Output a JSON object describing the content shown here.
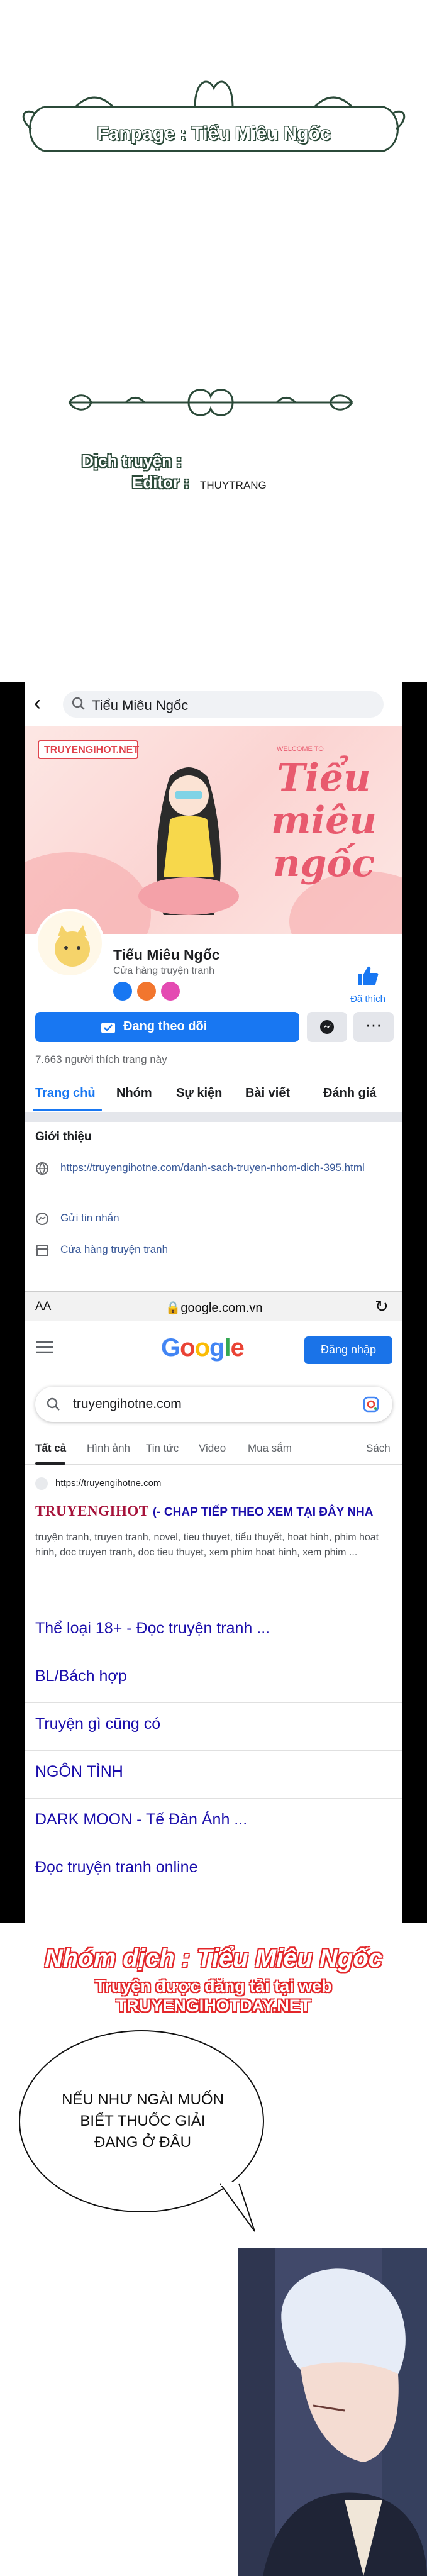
{
  "credit_top": {
    "fanpage": "Fanpage : Tiểu Miêu Ngốc",
    "translator_label": "Dịch truyện :",
    "editor_label": "Editor :",
    "editor_name": "THUYTRANG"
  },
  "facebook": {
    "search_query": "Tiểu Miêu Ngốc",
    "cover_brand": "TRUYENGIHOT.NET",
    "cover_welcome": "WELCOME TO",
    "cover_title": "Tiểu miêu ngốc",
    "page_name": "Tiểu Miêu Ngốc",
    "page_category": "Cửa hàng truyện tranh",
    "like_label": "Đã thích",
    "follow_button": "Đang theo dõi",
    "more_button": "···",
    "likes_count": "7.663 người thích trang này",
    "tabs": [
      "Trang chủ",
      "Nhóm",
      "Sự kiện",
      "Bài viết",
      "Đánh giá"
    ],
    "intro_title": "Giới thiệu",
    "intro_link": "https://truyengihotne.com/danh-sach-truyen-nhom-dich-395.html",
    "intro_message": "Gửi tin nhắn",
    "intro_category": "Cửa hàng truyện tranh"
  },
  "safari": {
    "aa": "AA",
    "url": "google.com.vn",
    "reload": "↻"
  },
  "google": {
    "logo": [
      "G",
      "o",
      "o",
      "g",
      "l",
      "e"
    ],
    "logo_colors": [
      "#4285f4",
      "#ea4335",
      "#fbbc05",
      "#4285f4",
      "#34a853",
      "#ea4335"
    ],
    "login_button": "Đăng nhập",
    "search_query": "truyengihotne.com",
    "tabs": [
      "Tất cả",
      "Hình ảnh",
      "Tin tức",
      "Video",
      "Mua sắm",
      "Sách"
    ],
    "source_url": "https://truyengihotne.com",
    "result_title_brand": "TRUYENGIHOT",
    "result_title_rest": "(- CHAP TIẾP THEO XEM TẠI ĐÂY NHA",
    "snippet": "truyện tranh, truyen tranh, novel, tieu thuyet, tiểu thuyết, hoat hinh, phim hoat hinh, doc truyen tranh, doc tieu thuyet, xem phim hoat hinh, xem phim ...",
    "sitelinks": [
      "Thể loại 18+ - Đọc truyện tranh ...",
      "BL/Bách hợp",
      "Truyện gì cũng có",
      "NGÔN TÌNH",
      "DARK MOON - Tế Đàn Ánh ...",
      "Đọc truyện tranh online"
    ]
  },
  "group_credit": {
    "line1": "Nhóm dịch : Tiểu Miêu Ngốc",
    "line2": "Truyện được đăng tải tại web TRUYENGIHOTDAY.NET"
  },
  "comic": {
    "speech": "NẾU NHƯ NGÀI MUỐN BIẾT THUỐC GIẢI ĐANG Ở ĐÂU"
  },
  "colors": {
    "facebook_blue": "#1877f2",
    "google_link": "#1a0dab",
    "credit_red": "#e3262a",
    "ornament_green": "#2b4a39"
  }
}
